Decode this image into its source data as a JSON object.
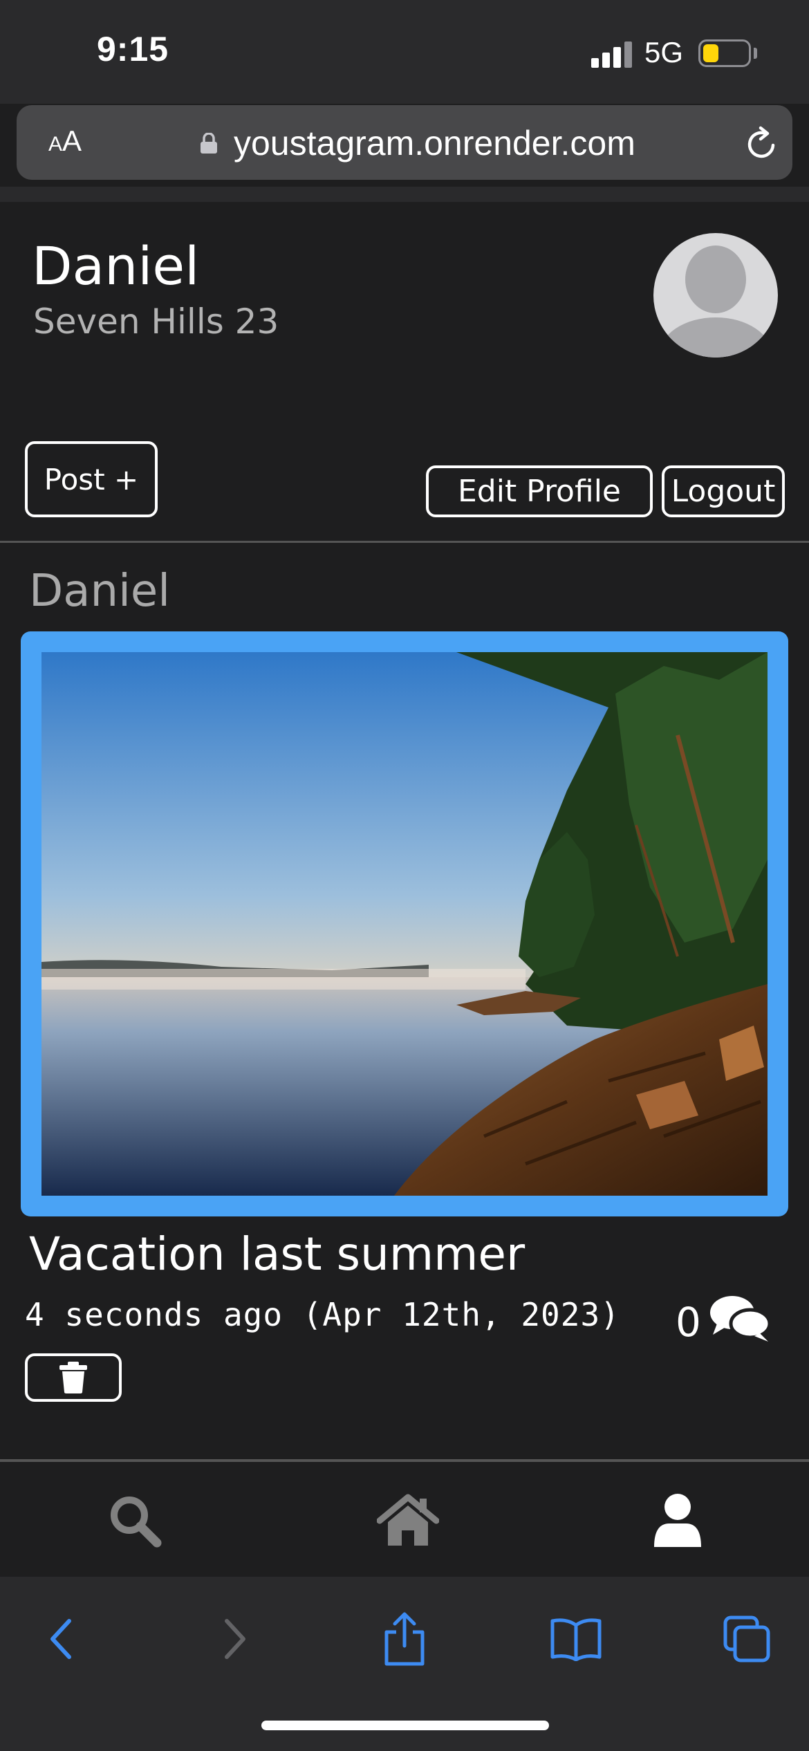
{
  "status_bar": {
    "time": "9:15",
    "network": "5G",
    "battery_level": 0.35,
    "battery_color": "#ffd60a"
  },
  "browser": {
    "text_size_label_small": "A",
    "text_size_label_large": "A",
    "url": "youstagram.onrender.com"
  },
  "profile": {
    "name": "Daniel",
    "location": "Seven Hills 23",
    "post_button": "Post +",
    "edit_button": "Edit Profile",
    "logout_button": "Logout"
  },
  "post": {
    "author": "Daniel",
    "image_icon": "lake-landscape-photo",
    "title": "Vacation last summer",
    "timestamp": "4 seconds ago (Apr 12th, 2023)",
    "comment_count": "0",
    "delete_icon": "trash-icon",
    "frame_color": "#4aa3f5"
  },
  "app_nav": {
    "items": [
      {
        "icon": "search-icon",
        "active": false
      },
      {
        "icon": "home-icon",
        "active": false
      },
      {
        "icon": "user-icon",
        "active": true
      }
    ]
  },
  "safari_toolbar": {
    "items": [
      "back-icon",
      "forward-icon",
      "share-icon",
      "bookmarks-icon",
      "tabs-icon"
    ],
    "accent_color": "#3d8bf2"
  }
}
